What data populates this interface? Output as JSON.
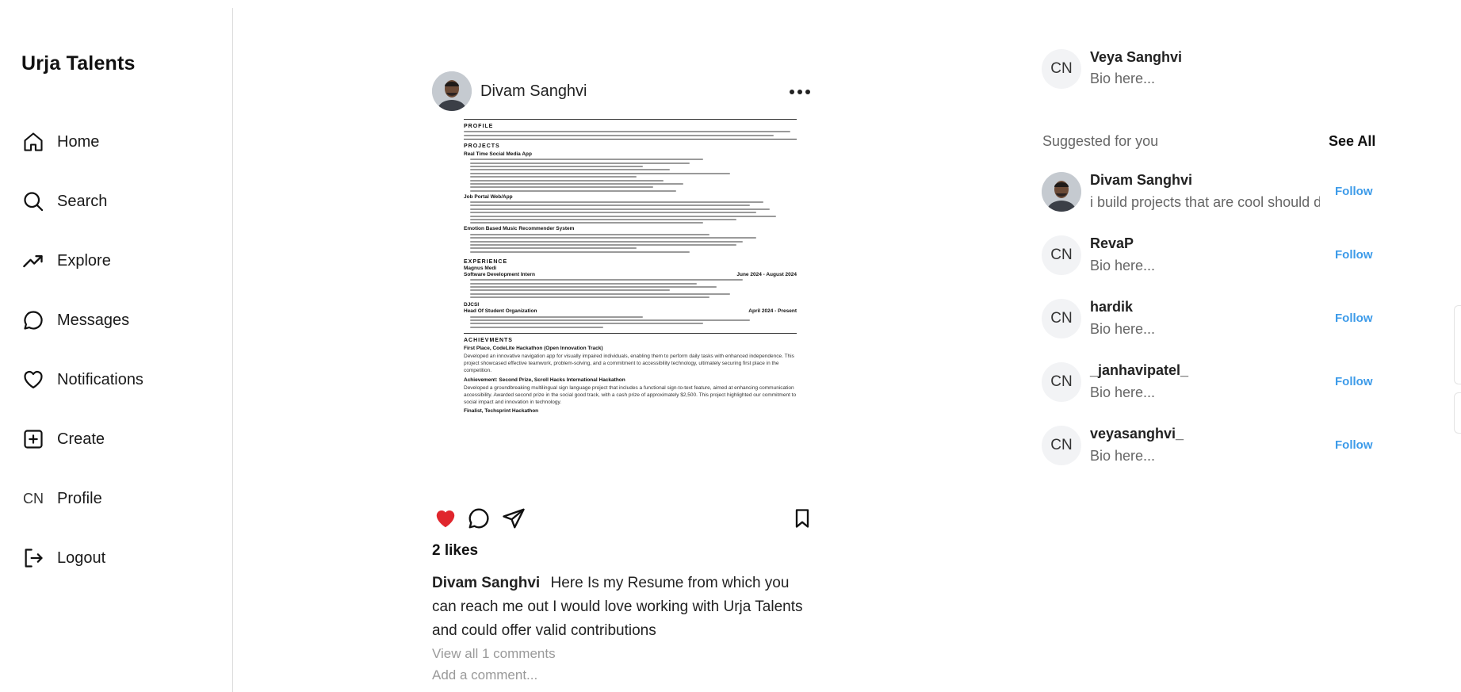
{
  "app": {
    "brand": "Urja Talents"
  },
  "nav": {
    "home": "Home",
    "search": "Search",
    "explore": "Explore",
    "messages": "Messages",
    "notifications": "Notifications",
    "create": "Create",
    "profile": "Profile",
    "profile_avatar": "CN",
    "logout": "Logout"
  },
  "post": {
    "author": "Divam Sanghvi",
    "likes": "2 likes",
    "caption_user": "Divam Sanghvi",
    "caption_text": "Here Is my Resume from which you can reach me out I would love working with Urja Talents and could offer valid contributions",
    "view_comments": "View all 1 comments",
    "comment_placeholder": "Add a comment...",
    "liked": true,
    "like_color": "#e0262d",
    "resume": {
      "profile_heading": "PROFILE",
      "projects_heading": "PROJECTS",
      "project_1": "Real Time Social Media App",
      "project_2": "Job Portal Web/App",
      "project_3": "Emotion Based Music Recommender System",
      "experience_heading": "EXPERIENCE",
      "exp_company_1": "Magnus Medi",
      "exp_role_1": "Software Development Intern",
      "exp_date_1": "June 2024 - August 2024",
      "exp_company_2": "DJCSI",
      "exp_role_2": "Head Of Student Organization",
      "exp_date_2": "April 2024 - Present",
      "achievements_heading": "ACHIEVMENTS",
      "ach_1": "First Place, CodeLite Hackathon (Open Innovation Track)",
      "ach_1_text": "Developed an innovative navigation app for visually impaired individuals, enabling them to perform daily tasks with enhanced independence. This project showcased effective teamwork, problem-solving, and a commitment to accessibility technology, ultimately securing first place in the competition.",
      "ach_2": "Achievement: Second Prize, Scroll Hacks International Hackathon",
      "ach_2_text": "Developed a groundbreaking multilingual sign language project that includes a functional sign-to-text feature, aimed at enhancing communication accessibility. Awarded second prize in the social good track, with a cash prize of approximately $2,500. This project highlighted our commitment to social impact and innovation in technology.",
      "ach_3": "Finalist, Techsprint Hackathon"
    }
  },
  "current_user": {
    "avatar": "CN",
    "name": "Veya Sanghvi",
    "bio": "Bio here..."
  },
  "suggestions": {
    "title": "Suggested for you",
    "see_all": "See All",
    "follow_color": "#3d9be9",
    "items": [
      {
        "avatar": "photo",
        "name": "Divam Sanghvi",
        "bio": "i build projects that are cool should d",
        "follow": "Follow"
      },
      {
        "avatar": "CN",
        "name": "RevaP",
        "bio": "Bio here...",
        "follow": "Follow"
      },
      {
        "avatar": "CN",
        "name": "hardik",
        "bio": "Bio here...",
        "follow": "Follow"
      },
      {
        "avatar": "CN",
        "name": "_janhavipatel_",
        "bio": "Bio here...",
        "follow": "Follow"
      },
      {
        "avatar": "CN",
        "name": "veyasanghvi_",
        "bio": "Bio here...",
        "follow": "Follow"
      }
    ]
  }
}
